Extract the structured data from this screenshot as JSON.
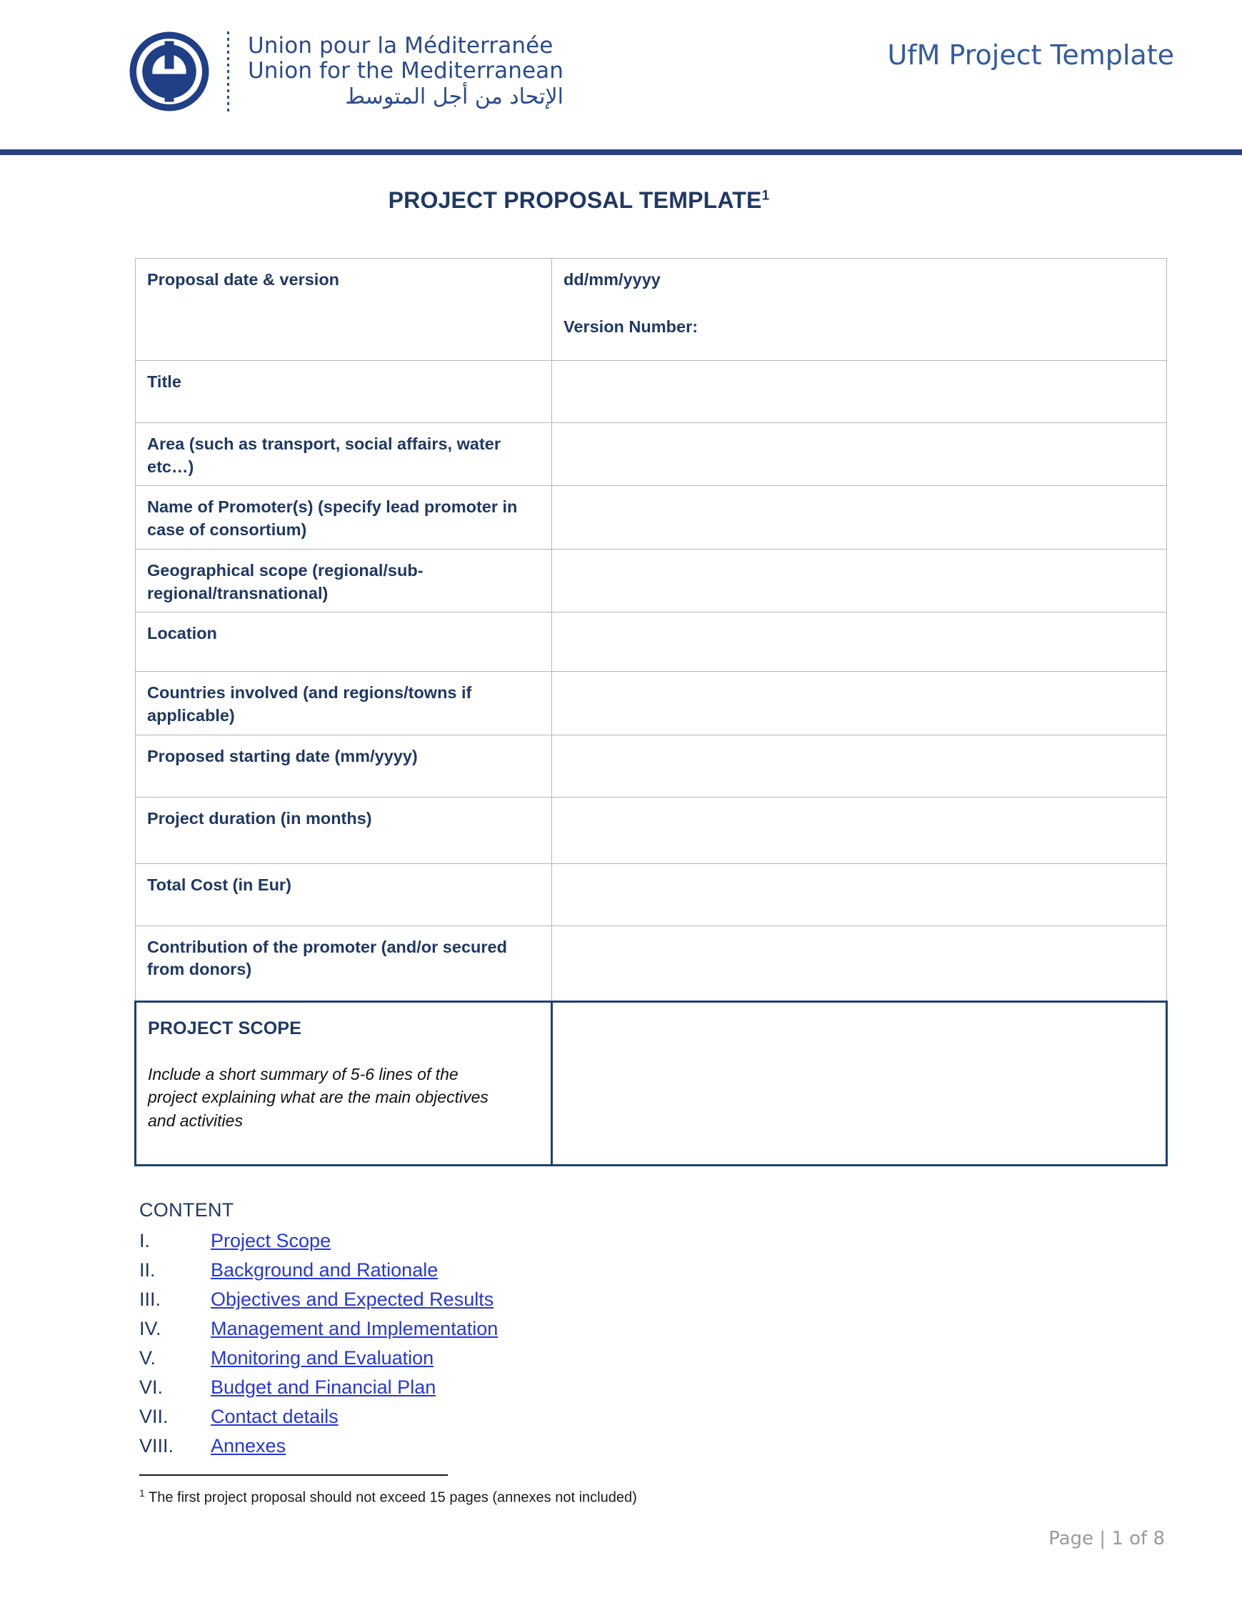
{
  "header": {
    "logo": {
      "alt_name": "ufm-logo",
      "line_fr": "Union pour la Méditerranée",
      "line_en": "Union for the Mediterranean",
      "line_ar": "الإتحاد من أجل المتوسط",
      "mark_color": "#1f3f87"
    },
    "title": "UfM Project Template",
    "rule_color": "#2a3f7e"
  },
  "document": {
    "title": "PROJECT PROPOSAL TEMPLATE",
    "title_footnote_marker": "1"
  },
  "form_table": {
    "rows": [
      {
        "label": "Proposal date & version",
        "value_line1": "dd/mm/yyyy",
        "value_line2": "Version Number:"
      },
      {
        "label": "Title",
        "value": ""
      },
      {
        "label": "Area (such as transport, social affairs, water etc…)",
        "value": ""
      },
      {
        "label": "Name of Promoter(s) (specify lead promoter in case of consortium)",
        "value": ""
      },
      {
        "label": "Geographical scope (regional/sub-regional/transnational)",
        "value": ""
      },
      {
        "label": "Location",
        "value": ""
      },
      {
        "label": "Countries involved (and regions/towns if applicable)",
        "value": ""
      },
      {
        "label": "Proposed starting date (mm/yyyy)",
        "value": ""
      },
      {
        "label": "Project duration (in months)",
        "value": ""
      },
      {
        "label": "Total Cost (in Eur)",
        "value": ""
      },
      {
        "label": "Contribution of the promoter (and/or secured from donors)",
        "value": ""
      }
    ],
    "scope_row": {
      "heading": "PROJECT SCOPE",
      "note": "Include a short summary of 5-6 lines of the project explaining what are the main objectives and activities",
      "value": "",
      "border_color": "#1f4070"
    }
  },
  "content": {
    "heading": "CONTENT",
    "items": [
      {
        "numeral": "I.",
        "label": "Project Scope"
      },
      {
        "numeral": "II.",
        "label": "Background and Rationale"
      },
      {
        "numeral": "III.",
        "label": "Objectives and Expected Results"
      },
      {
        "numeral": "IV.",
        "label": "Management and Implementation"
      },
      {
        "numeral": "V.",
        "label": "Monitoring and Evaluation"
      },
      {
        "numeral": "VI.",
        "label": "Budget and Financial Plan"
      },
      {
        "numeral": "VII.",
        "label": "Contact details"
      },
      {
        "numeral": "VIII.",
        "label": "Annexes"
      }
    ],
    "link_color": "#2637d6"
  },
  "footnote": {
    "marker": "1",
    "text": " The first project proposal should not exceed 15 pages (annexes not included)"
  },
  "footer": {
    "page_label": "Page | 1 of 8"
  }
}
